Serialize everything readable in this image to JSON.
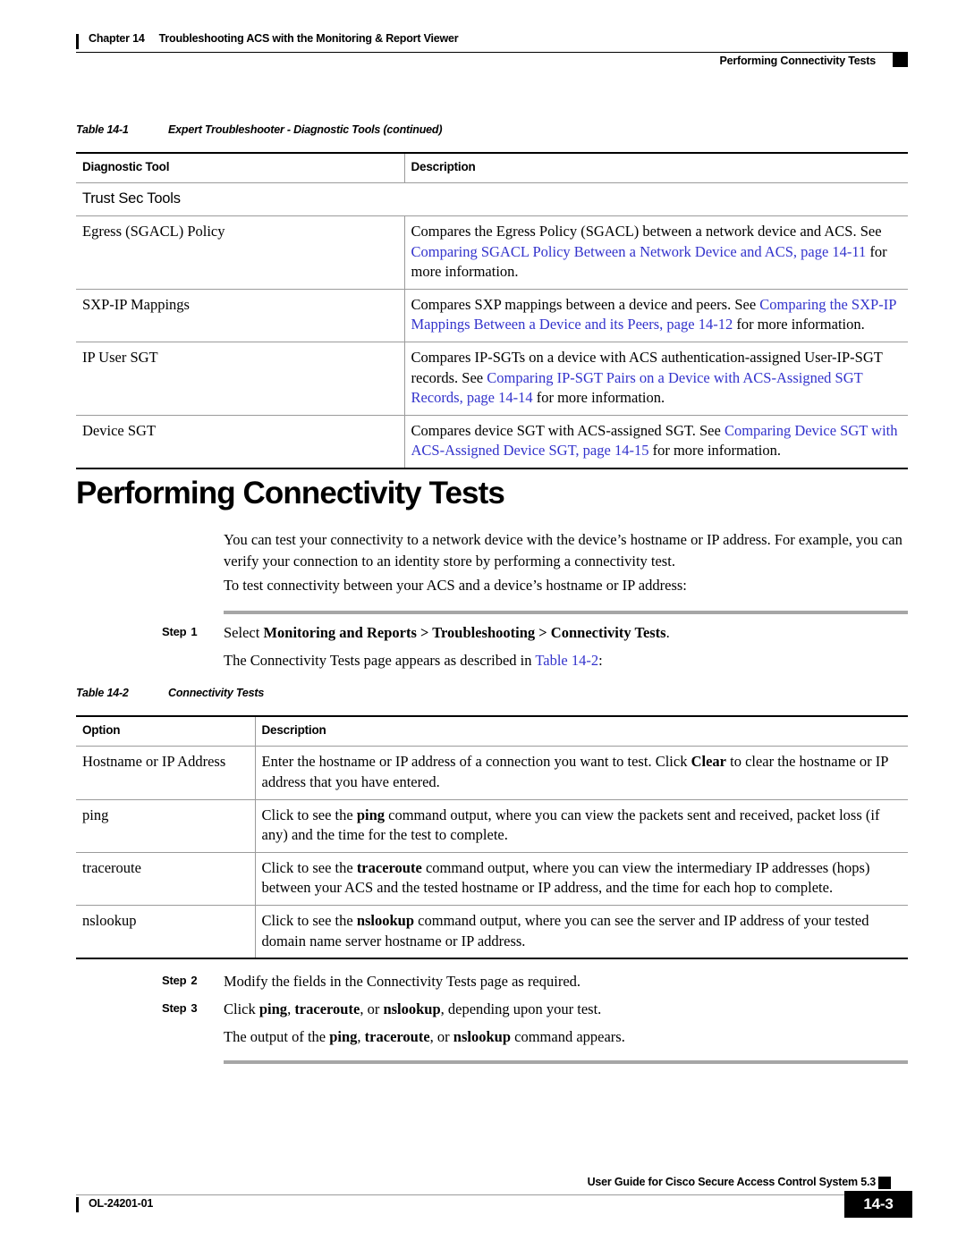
{
  "header": {
    "chapter_label": "Chapter 14",
    "chapter_title": "Troubleshooting ACS with the Monitoring & Report Viewer",
    "section_title": "Performing Connectivity Tests"
  },
  "table1": {
    "caption_label": "Table 14-1",
    "caption_title": "Expert Troubleshooter - Diagnostic Tools (continued)",
    "columns": [
      "Diagnostic Tool",
      "Description"
    ],
    "group_heading": "Trust Sec Tools",
    "rows": [
      {
        "tool": "Egress (SGACL) Policy",
        "desc_pre": "Compares the Egress Policy (SGACL) between a network device and ACS. See ",
        "desc_link": "Comparing SGACL Policy Between a Network Device and ACS, page 14-11",
        "desc_post": " for more information."
      },
      {
        "tool": "SXP-IP Mappings",
        "desc_pre": "Compares SXP mappings between a device and peers. See ",
        "desc_link": "Comparing the SXP-IP Mappings Between a Device and its Peers, page 14-12",
        "desc_post": " for more information."
      },
      {
        "tool": "IP User SGT",
        "desc_pre": "Compares IP-SGTs on a device with ACS authentication-assigned User-IP-SGT records. See ",
        "desc_link": "Comparing IP-SGT Pairs on a Device with ACS-Assigned SGT Records, page 14-14",
        "desc_post": " for more information."
      },
      {
        "tool": "Device SGT",
        "desc_pre": "Compares device SGT with ACS-assigned SGT. See ",
        "desc_link": "Comparing Device SGT with ACS-Assigned Device SGT, page 14-15",
        "desc_post": " for more information."
      }
    ]
  },
  "section": {
    "heading": "Performing Connectivity Tests",
    "para1": "You can test your connectivity to a network device with the device’s hostname or IP address. For example, you can verify your connection to an identity store by performing a connectivity test.",
    "para2": "To test connectivity between your ACS and a device’s hostname or IP address:"
  },
  "steps": {
    "step1": {
      "label": "Step",
      "number": "1",
      "text_pre": "Select ",
      "text_bold": "Monitoring and Reports > Troubleshooting > Connectivity Tests",
      "text_post": ".",
      "followup_pre": "The Connectivity Tests page appears as described in ",
      "followup_link": "Table 14-2",
      "followup_post": ":"
    },
    "step2": {
      "label": "Step",
      "number": "2",
      "text": "Modify the fields in the Connectivity Tests page as required."
    },
    "step3": {
      "label": "Step",
      "number": "3",
      "text_parts": [
        {
          "t": "Click ",
          "b": false
        },
        {
          "t": "ping",
          "b": true
        },
        {
          "t": ", ",
          "b": false
        },
        {
          "t": "traceroute",
          "b": true
        },
        {
          "t": ", or ",
          "b": false
        },
        {
          "t": "nslookup",
          "b": true
        },
        {
          "t": ", depending upon your test.",
          "b": false
        }
      ],
      "followup_parts": [
        {
          "t": "The output of the ",
          "b": false
        },
        {
          "t": "ping",
          "b": true
        },
        {
          "t": ", ",
          "b": false
        },
        {
          "t": "traceroute",
          "b": true
        },
        {
          "t": ", or ",
          "b": false
        },
        {
          "t": "nslookup",
          "b": true
        },
        {
          "t": " command appears.",
          "b": false
        }
      ]
    }
  },
  "table2": {
    "caption_label": "Table 14-2",
    "caption_title": "Connectivity Tests",
    "columns": [
      "Option",
      "Description"
    ],
    "rows": [
      {
        "option": "Hostname or IP Address",
        "desc_parts": [
          {
            "t": "Enter the hostname or IP address of a connection you want to test. Click ",
            "b": false
          },
          {
            "t": "Clear",
            "b": true
          },
          {
            "t": " to clear the hostname or IP address that you have entered.",
            "b": false
          }
        ]
      },
      {
        "option": "ping",
        "desc_parts": [
          {
            "t": "Click to see the ",
            "b": false
          },
          {
            "t": "ping",
            "b": true
          },
          {
            "t": " command output, where you can view the packets sent and received, packet loss (if any) and the time for the test to complete.",
            "b": false
          }
        ]
      },
      {
        "option": "traceroute",
        "desc_parts": [
          {
            "t": "Click to see the ",
            "b": false
          },
          {
            "t": "traceroute",
            "b": true
          },
          {
            "t": " command output, where you can view the intermediary IP addresses (hops) between your ACS and the tested hostname or IP address, and the time for each hop to complete.",
            "b": false
          }
        ]
      },
      {
        "option": "nslookup",
        "desc_parts": [
          {
            "t": "Click to see the ",
            "b": false
          },
          {
            "t": "nslookup",
            "b": true
          },
          {
            "t": " command output, where you can see the server and IP address of your tested domain name server hostname or IP address.",
            "b": false
          }
        ]
      }
    ]
  },
  "footer": {
    "guide_title": "User Guide for Cisco Secure Access Control System 5.3",
    "doc_id": "OL-24201-01",
    "page_number": "14-3"
  },
  "colors": {
    "link": "#3333cc",
    "rule_dark": "#000000",
    "rule_light": "#9b9b9b",
    "step_rule": "#a6a6a6"
  }
}
